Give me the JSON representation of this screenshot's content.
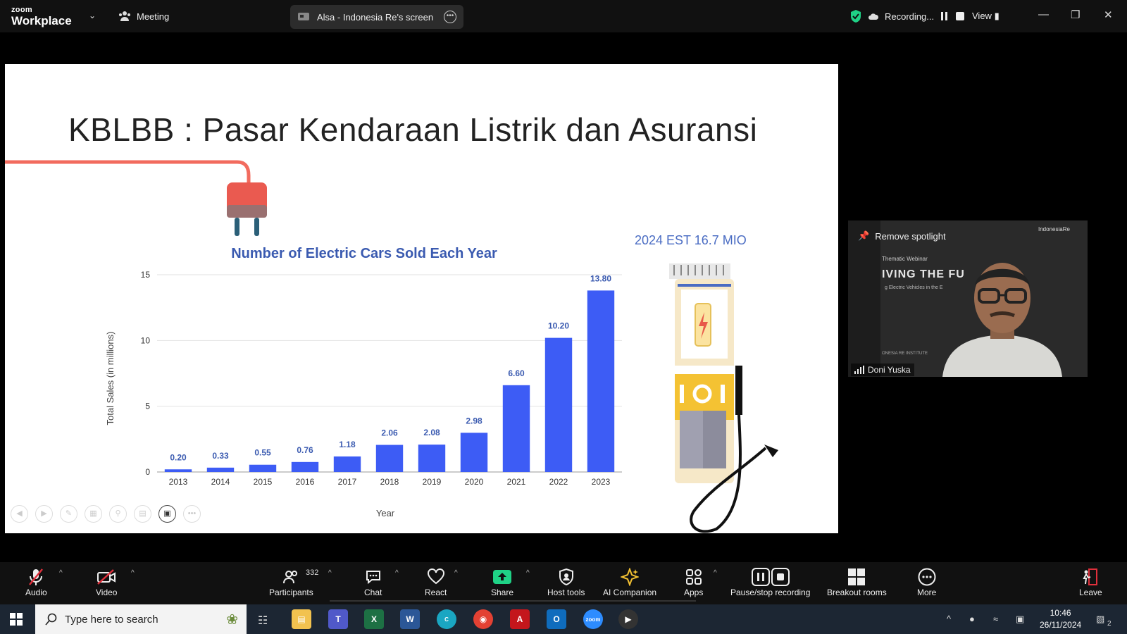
{
  "titlebar": {
    "logo_top": "zoom",
    "logo_bottom": "Workplace",
    "meeting_label": "Meeting",
    "share_label": "Alsa - Indonesia Re's screen",
    "recording_label": "Recording...",
    "view_label": "View"
  },
  "slide": {
    "title": "KBLBB : Pasar Kendaraan Listrik dan Asuransi",
    "estimate_label": "2024 EST 16.7 MIO"
  },
  "chart_data": {
    "type": "bar",
    "title": "Number of Electric Cars Sold Each Year",
    "xlabel": "Year",
    "ylabel": "Total Sales (in millions)",
    "ylim": [
      0,
      15
    ],
    "yticks": [
      0,
      5,
      10,
      15
    ],
    "grid": true,
    "categories": [
      "2013",
      "2014",
      "2015",
      "2016",
      "2017",
      "2018",
      "2019",
      "2020",
      "2021",
      "2022",
      "2023"
    ],
    "values": [
      0.2,
      0.33,
      0.55,
      0.76,
      1.18,
      2.06,
      2.08,
      2.98,
      6.6,
      10.2,
      13.8
    ],
    "value_labels": [
      "0.20",
      "0.33",
      "0.55",
      "0.76",
      "1.18",
      "2.06",
      "2.08",
      "2.98",
      "6.60",
      "10.20",
      "13.80"
    ],
    "bar_color": "#3d5cf5"
  },
  "video_tile": {
    "remove_spotlight": "Remove spotlight",
    "participant_name": "Doni Yuska",
    "bg_line1": "Thematic Webinar",
    "bg_line2": "IVING THE FU",
    "bg_line3": "g Electric Vehicles in the E",
    "bg_line4": "ONESIA RE INSTITUTE",
    "brand": "IndonesiaRe"
  },
  "toolbar": {
    "audio": "Audio",
    "video": "Video",
    "participants": "Participants",
    "participants_count": "332",
    "chat": "Chat",
    "react": "React",
    "share": "Share",
    "host_tools": "Host tools",
    "ai_companion": "AI Companion",
    "apps": "Apps",
    "pause_stop": "Pause/stop recording",
    "breakout": "Breakout rooms",
    "more": "More",
    "leave": "Leave"
  },
  "taskbar": {
    "search_placeholder": "Type here to search",
    "time": "10:46",
    "date": "26/11/2024",
    "notif_count": "2"
  },
  "colors": {
    "accent_green": "#1fd286",
    "leave_red": "#e0303c",
    "chart_title": "#3a5ab0"
  }
}
